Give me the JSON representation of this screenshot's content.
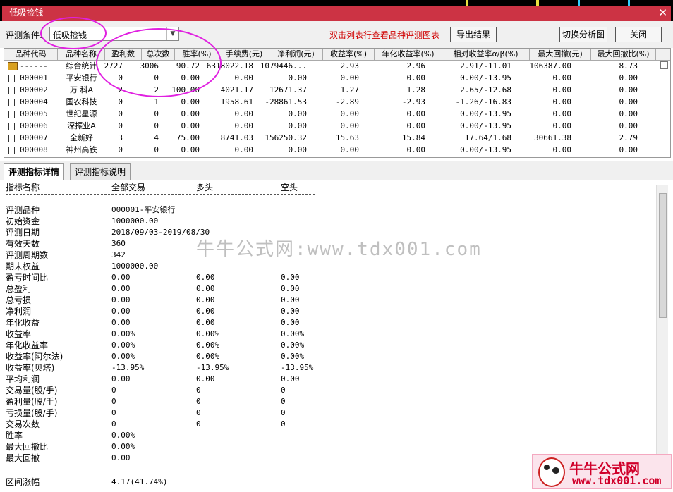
{
  "window": {
    "title": "-低吸捡钱",
    "close_glyph": "✕"
  },
  "toolbar": {
    "cond_label": "评测条件:",
    "cond_value": "低吸捡钱",
    "hint": "双击列表行查看品种评测图表",
    "export_label": "导出结果",
    "switch_label": "切换分析图",
    "close_label": "关闭"
  },
  "table": {
    "columns": [
      "品种代码",
      "品种名称",
      "盈利数",
      "总次数",
      "胜率(%)",
      "手续费(元)",
      "净利润(元)",
      "收益率(%)",
      "年化收益率(%)",
      "相对收益率α/β(%)",
      "最大回撤(元)",
      "最大回撤比(%)"
    ],
    "summary": {
      "code": "------",
      "name": "综合统计",
      "cells": [
        "2727",
        "3006",
        "90.72",
        "6318022.18",
        "1079446...",
        "2.93",
        "2.96",
        "2.91/-11.01",
        "106387.00",
        "8.73"
      ]
    },
    "rows": [
      {
        "code": "000001",
        "name": "平安银行",
        "cells": [
          "0",
          "0",
          "0.00",
          "0.00",
          "0.00",
          "0.00",
          "0.00",
          "0.00/-13.95",
          "0.00",
          "0.00"
        ]
      },
      {
        "code": "000002",
        "name": "万 科A",
        "cells": [
          "2",
          "2",
          "100.00",
          "4021.17",
          "12671.37",
          "1.27",
          "1.28",
          "2.65/-12.68",
          "0.00",
          "0.00"
        ]
      },
      {
        "code": "000004",
        "name": "国农科技",
        "cells": [
          "0",
          "1",
          "0.00",
          "1958.61",
          "-28861.53",
          "-2.89",
          "-2.93",
          "-1.26/-16.83",
          "0.00",
          "0.00"
        ]
      },
      {
        "code": "000005",
        "name": "世纪星源",
        "cells": [
          "0",
          "0",
          "0.00",
          "0.00",
          "0.00",
          "0.00",
          "0.00",
          "0.00/-13.95",
          "0.00",
          "0.00"
        ]
      },
      {
        "code": "000006",
        "name": "深振业A",
        "cells": [
          "0",
          "0",
          "0.00",
          "0.00",
          "0.00",
          "0.00",
          "0.00",
          "0.00/-13.95",
          "0.00",
          "0.00"
        ]
      },
      {
        "code": "000007",
        "name": "全新好",
        "cells": [
          "3",
          "4",
          "75.00",
          "8741.03",
          "156250.32",
          "15.63",
          "15.84",
          "17.64/1.68",
          "30661.38",
          "2.79"
        ]
      },
      {
        "code": "000008",
        "name": "神州高铁",
        "cells": [
          "0",
          "0",
          "0.00",
          "0.00",
          "0.00",
          "0.00",
          "0.00",
          "0.00/-13.95",
          "0.00",
          "0.00"
        ]
      }
    ]
  },
  "tabs": [
    "评测指标详情",
    "评测指标说明"
  ],
  "detail": {
    "headers": [
      "指标名称",
      "全部交易",
      "多头",
      "空头"
    ],
    "rows": [
      {
        "label": "评测品种",
        "v": [
          "000001-平安银行",
          "",
          ""
        ]
      },
      {
        "label": "初始资金",
        "v": [
          "1000000.00",
          "",
          ""
        ]
      },
      {
        "label": "评测日期",
        "v": [
          "2018/09/03-2019/08/30",
          "",
          ""
        ]
      },
      {
        "label": "有效天数",
        "v": [
          "360",
          "",
          ""
        ]
      },
      {
        "label": "评测周期数",
        "v": [
          "342",
          "",
          ""
        ]
      },
      {
        "label": "期末权益",
        "v": [
          "1000000.00",
          "",
          ""
        ]
      },
      {
        "label": "盈亏时间比",
        "v": [
          "0.00",
          "0.00",
          "0.00"
        ]
      },
      {
        "label": "总盈利",
        "v": [
          "0.00",
          "0.00",
          "0.00"
        ]
      },
      {
        "label": "总亏损",
        "v": [
          "0.00",
          "0.00",
          "0.00"
        ]
      },
      {
        "label": "净利润",
        "v": [
          "0.00",
          "0.00",
          "0.00"
        ]
      },
      {
        "label": "年化收益",
        "v": [
          "0.00",
          "0.00",
          "0.00"
        ]
      },
      {
        "label": "收益率",
        "v": [
          "0.00%",
          "0.00%",
          "0.00%"
        ]
      },
      {
        "label": "年化收益率",
        "v": [
          "0.00%",
          "0.00%",
          "0.00%"
        ]
      },
      {
        "label": "收益率(阿尔法)",
        "v": [
          "0.00%",
          "0.00%",
          "0.00%"
        ]
      },
      {
        "label": "收益率(贝塔)",
        "v": [
          "-13.95%",
          "-13.95%",
          "-13.95%"
        ]
      },
      {
        "label": "平均利润",
        "v": [
          "0.00",
          "0.00",
          "0.00"
        ]
      },
      {
        "label": "交易量(股/手)",
        "v": [
          "0",
          "0",
          "0"
        ]
      },
      {
        "label": "盈利量(股/手)",
        "v": [
          "0",
          "0",
          "0"
        ]
      },
      {
        "label": "亏损量(股/手)",
        "v": [
          "0",
          "0",
          "0"
        ]
      },
      {
        "label": "交易次数",
        "v": [
          "0",
          "0",
          "0"
        ]
      },
      {
        "label": "胜率",
        "v": [
          "0.00%",
          "",
          ""
        ]
      },
      {
        "label": "最大回撤比",
        "v": [
          "0.00%",
          "",
          ""
        ]
      },
      {
        "label": "最大回撤",
        "v": [
          "0.00",
          "",
          ""
        ]
      }
    ],
    "range_label": "区间涨幅",
    "range_value": "4.17(41.74%)"
  },
  "watermark": "牛牛公式网:www.tdx001.com",
  "logo": {
    "name": "牛牛公式网",
    "url": "www.tdx001.com"
  },
  "colors": {
    "title_bar": "#cc3344",
    "hint": "#d00000",
    "circle": "#e020e0",
    "logo": "#d0002a"
  }
}
